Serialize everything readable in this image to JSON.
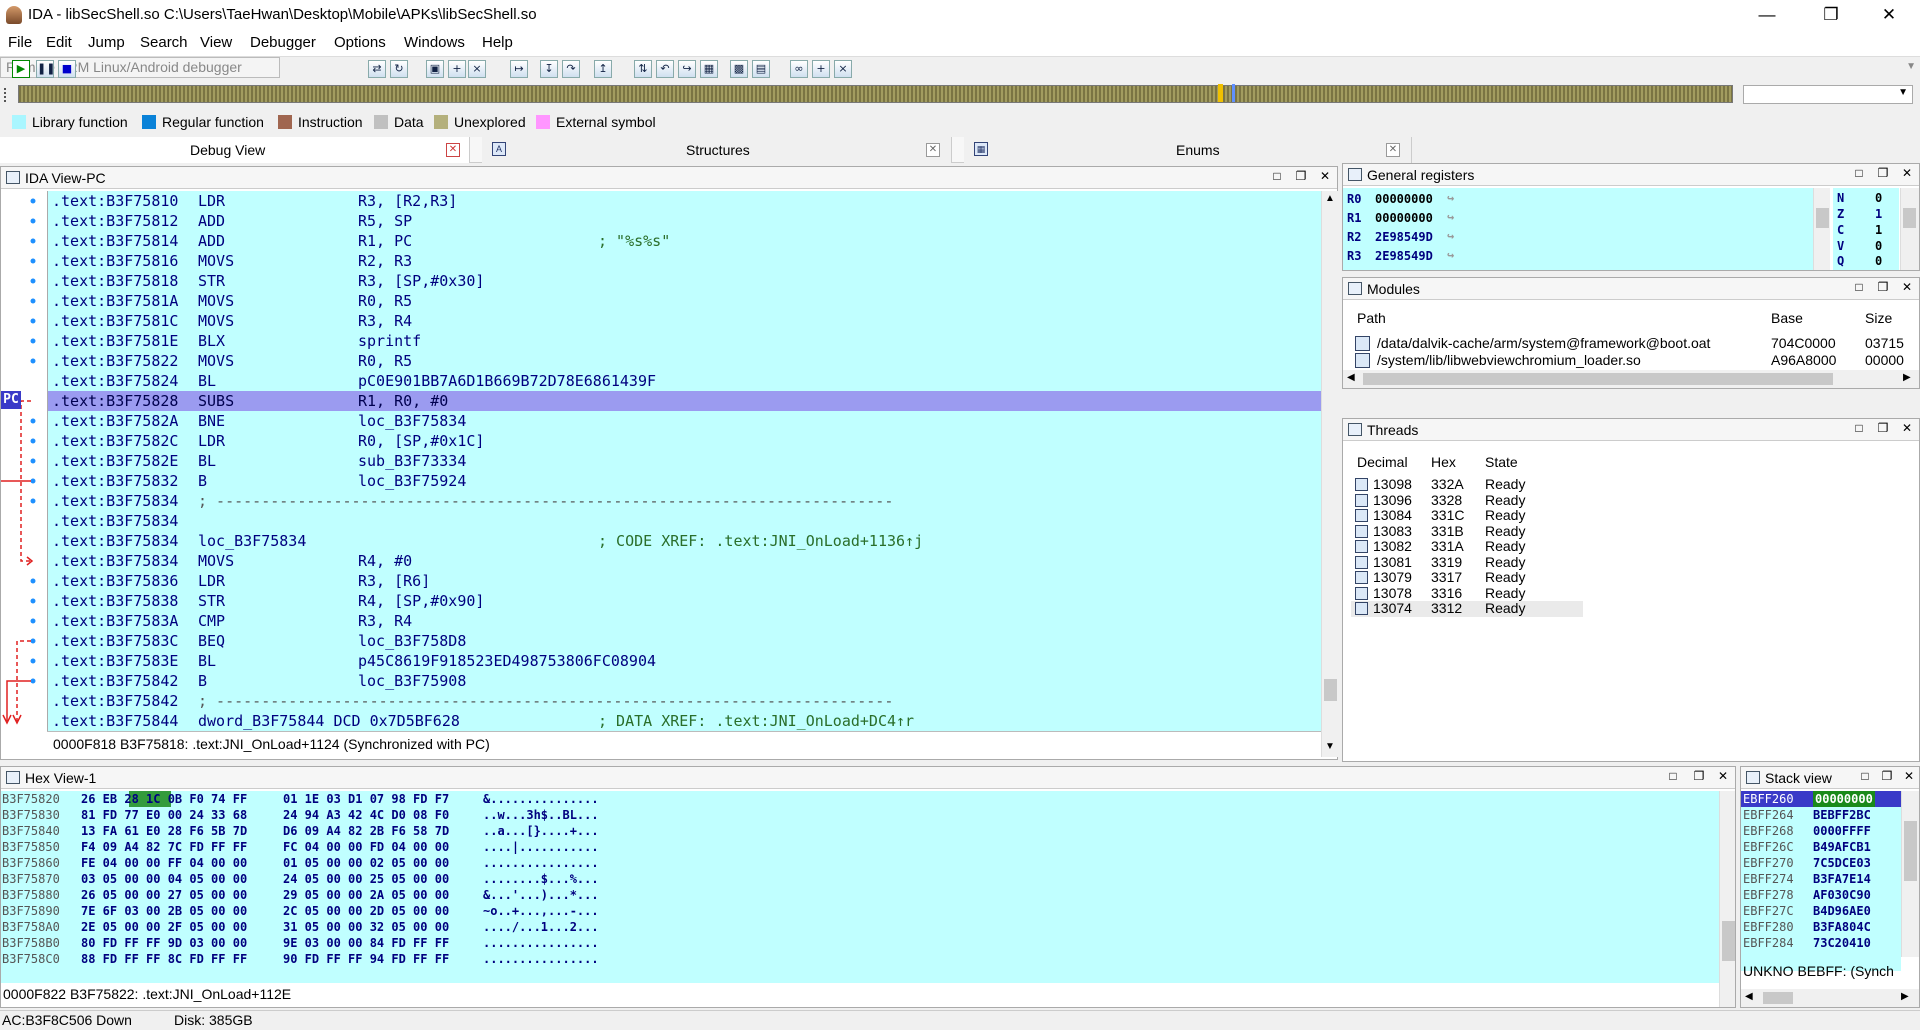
{
  "window": {
    "title": "IDA - libSecShell.so C:\\Users\\TaeHwan\\Desktop\\Mobile\\APKs\\libSecShell.so"
  },
  "menu": [
    "File",
    "Edit",
    "Jump",
    "Search",
    "View",
    "Debugger",
    "Options",
    "Windows",
    "Help"
  ],
  "toolbar": {
    "debugger_select": "Remote ARM Linux/Android debugger"
  },
  "legend": [
    {
      "label": "Library function",
      "color": "#aaf6ff"
    },
    {
      "label": "Regular function",
      "color": "#0a82d8"
    },
    {
      "label": "Instruction",
      "color": "#a06650"
    },
    {
      "label": "Data",
      "color": "#c0c0c0"
    },
    {
      "label": "Unexplored",
      "color": "#b4b07c"
    },
    {
      "label": "External symbol",
      "color": "#ff96ff"
    }
  ],
  "tabs": [
    {
      "label": "Debug View"
    },
    {
      "label": "Structures"
    },
    {
      "label": "Enums"
    }
  ],
  "ida_view": {
    "title": "IDA View-PC",
    "pc_label": "PC",
    "lines": [
      {
        "addr": ".text:B3F75810",
        "mn": "LDR",
        "op": "R3, [R2,R3]",
        "cm": ""
      },
      {
        "addr": ".text:B3F75812",
        "mn": "ADD",
        "op": "R5, SP",
        "cm": ""
      },
      {
        "addr": ".text:B3F75814",
        "mn": "ADD",
        "op": "R1, PC",
        "cm": "; \"%s%s\""
      },
      {
        "addr": ".text:B3F75816",
        "mn": "MOVS",
        "op": "R2, R3",
        "cm": ""
      },
      {
        "addr": ".text:B3F75818",
        "mn": "STR",
        "op": "R3, [SP,#0x30]",
        "cm": ""
      },
      {
        "addr": ".text:B3F7581A",
        "mn": "MOVS",
        "op": "R0, R5",
        "cm": ""
      },
      {
        "addr": ".text:B3F7581C",
        "mn": "MOVS",
        "op": "R3, R4",
        "cm": ""
      },
      {
        "addr": ".text:B3F7581E",
        "mn": "BLX",
        "op": "sprintf",
        "cm": ""
      },
      {
        "addr": ".text:B3F75822",
        "mn": "MOVS",
        "op": "R0, R5",
        "cm": ""
      },
      {
        "addr": ".text:B3F75824",
        "mn": "BL",
        "op": "pC0E901BB7A6D1B669B72D78E6861439F",
        "cm": ""
      },
      {
        "addr": ".text:B3F75828",
        "mn": "SUBS",
        "op": "R1, R0, #0",
        "cm": ""
      },
      {
        "addr": ".text:B3F7582A",
        "mn": "BNE",
        "op": "loc_B3F75834",
        "cm": ""
      },
      {
        "addr": ".text:B3F7582C",
        "mn": "LDR",
        "op": "R0, [SP,#0x1C]",
        "cm": ""
      },
      {
        "addr": ".text:B3F7582E",
        "mn": "BL",
        "op": "sub_B3F73334",
        "cm": ""
      },
      {
        "addr": ".text:B3F75832",
        "mn": "B",
        "op": "loc_B3F75924",
        "cm": ""
      },
      {
        "addr": ".text:B3F75834",
        "mn": "; ---------------------------------------------------------------------------",
        "op": "",
        "cm": ""
      },
      {
        "addr": ".text:B3F75834",
        "mn": "",
        "op": "",
        "cm": ""
      },
      {
        "addr": ".text:B3F75834",
        "mn": "loc_B3F75834",
        "op": "",
        "cm": "; CODE XREF: .text:JNI_OnLoad+1136↑j"
      },
      {
        "addr": ".text:B3F75834",
        "mn": "MOVS",
        "op": "R4, #0",
        "cm": ""
      },
      {
        "addr": ".text:B3F75836",
        "mn": "LDR",
        "op": "R3, [R6]",
        "cm": ""
      },
      {
        "addr": ".text:B3F75838",
        "mn": "STR",
        "op": "R4, [SP,#0x90]",
        "cm": ""
      },
      {
        "addr": ".text:B3F7583A",
        "mn": "CMP",
        "op": "R3, R4",
        "cm": ""
      },
      {
        "addr": ".text:B3F7583C",
        "mn": "BEQ",
        "op": "loc_B3F758D8",
        "cm": ""
      },
      {
        "addr": ".text:B3F7583E",
        "mn": "BL",
        "op": "p45C8619F918523ED498753806FC08904",
        "cm": ""
      },
      {
        "addr": ".text:B3F75842",
        "mn": "B",
        "op": "loc_B3F75908",
        "cm": ""
      },
      {
        "addr": ".text:B3F75842",
        "mn": "; ---------------------------------------------------------------------------",
        "op": "",
        "cm": ""
      },
      {
        "addr": ".text:B3F75844",
        "mn": "dword_B3F75844 DCD 0x7D5BF628",
        "op": "",
        "cm": "; DATA XREF: .text:JNI_OnLoad+DC4↑r"
      }
    ],
    "status": "0000F818 B3F75818: .text:JNI_OnLoad+1124 (Synchronized with PC)"
  },
  "general_registers": {
    "title": "General registers",
    "regs": [
      {
        "name": "R0",
        "value": "00000000"
      },
      {
        "name": "R1",
        "value": "00000000"
      },
      {
        "name": "R2",
        "value": "2E98549D"
      },
      {
        "name": "R3",
        "value": "2E98549D"
      }
    ],
    "flags": [
      {
        "name": "N",
        "value": "0"
      },
      {
        "name": "Z",
        "value": "1"
      },
      {
        "name": "C",
        "value": "1"
      },
      {
        "name": "V",
        "value": "0"
      },
      {
        "name": "Q",
        "value": "0"
      }
    ]
  },
  "modules": {
    "title": "Modules",
    "columns": [
      "Path",
      "Base",
      "Size"
    ],
    "rows": [
      {
        "path": "/data/dalvik-cache/arm/system@framework@boot.oat",
        "base": "704C0000",
        "size": "03715"
      },
      {
        "path": "/system/lib/libwebviewchromium_loader.so",
        "base": "A96A8000",
        "size": "00000"
      }
    ]
  },
  "threads": {
    "title": "Threads",
    "columns": [
      "Decimal",
      "Hex",
      "State"
    ],
    "rows": [
      {
        "dec": "13098",
        "hex": "332A",
        "state": "Ready"
      },
      {
        "dec": "13096",
        "hex": "3328",
        "state": "Ready"
      },
      {
        "dec": "13084",
        "hex": "331C",
        "state": "Ready"
      },
      {
        "dec": "13083",
        "hex": "331B",
        "state": "Ready"
      },
      {
        "dec": "13082",
        "hex": "331A",
        "state": "Ready"
      },
      {
        "dec": "13081",
        "hex": "3319",
        "state": "Ready"
      },
      {
        "dec": "13079",
        "hex": "3317",
        "state": "Ready"
      },
      {
        "dec": "13078",
        "hex": "3316",
        "state": "Ready"
      },
      {
        "dec": "13074",
        "hex": "3312",
        "state": "Ready"
      }
    ]
  },
  "hex_view": {
    "title": "Hex View-1",
    "rows": [
      {
        "addr": "B3F75820",
        "b1": "26 EB 28 1C 0B F0 74 FF",
        "b2": "01 1E 03 D1 07 98 FD F7",
        "chars": "&..............."
      },
      {
        "addr": "B3F75830",
        "b1": "81 FD 77 E0 00 24 33 68",
        "b2": "24 94 A3 42 4C D0 08 F0",
        "chars": "..w...3h$..BL..."
      },
      {
        "addr": "B3F75840",
        "b1": "13 FA 61 E0 28 F6 5B 7D",
        "b2": "D6 09 A4 82 2B F6 58 7D",
        "chars": "..a...[}....+..."
      },
      {
        "addr": "B3F75850",
        "b1": "F4 09 A4 82 7C FD FF FF",
        "b2": "FC 04 00 00 FD 04 00 00",
        "chars": "....|..........."
      },
      {
        "addr": "B3F75860",
        "b1": "FE 04 00 00 FF 04 00 00",
        "b2": "01 05 00 00 02 05 00 00",
        "chars": "................"
      },
      {
        "addr": "B3F75870",
        "b1": "03 05 00 00 04 05 00 00",
        "b2": "24 05 00 00 25 05 00 00",
        "chars": "........$...%..."
      },
      {
        "addr": "B3F75880",
        "b1": "26 05 00 00 27 05 00 00",
        "b2": "29 05 00 00 2A 05 00 00",
        "chars": "&...'...)...*..."
      },
      {
        "addr": "B3F75890",
        "b1": "7E 6F 03 00 2B 05 00 00",
        "b2": "2C 05 00 00 2D 05 00 00",
        "chars": "~o..+...,...-..."
      },
      {
        "addr": "B3F758A0",
        "b1": "2E 05 00 00 2F 05 00 00",
        "b2": "31 05 00 00 32 05 00 00",
        "chars": "..../...1...2..."
      },
      {
        "addr": "B3F758B0",
        "b1": "80 FD FF FF 9D 03 00 00",
        "b2": "9E 03 00 00 84 FD FF FF",
        "chars": "................"
      },
      {
        "addr": "B3F758C0",
        "b1": "88 FD FF FF 8C FD FF FF",
        "b2": "90 FD FF FF 94 FD FF FF",
        "chars": "................"
      }
    ],
    "status": "0000F822 B3F75822: .text:JNI_OnLoad+112E"
  },
  "stack_view": {
    "title": "Stack view",
    "rows": [
      {
        "addr": "EBFF260",
        "val": "00000000"
      },
      {
        "addr": "EBFF264",
        "val": "BEBFF2BC"
      },
      {
        "addr": "EBFF268",
        "val": "0000FFFF"
      },
      {
        "addr": "EBFF26C",
        "val": "B49AFCB1"
      },
      {
        "addr": "EBFF270",
        "val": "7C5DCE03"
      },
      {
        "addr": "EBFF274",
        "val": "B3FA7E14"
      },
      {
        "addr": "EBFF278",
        "val": "AF030C90"
      },
      {
        "addr": "EBFF27C",
        "val": "B4D96AE0"
      },
      {
        "addr": "EBFF280",
        "val": "B3FA804C"
      },
      {
        "addr": "EBFF284",
        "val": "73C20410"
      }
    ],
    "status": "UNKNO BEBFF: (Synch"
  },
  "bottom_status": {
    "ac": "AC:B3F8C506 Down",
    "disk": "Disk: 385GB"
  }
}
